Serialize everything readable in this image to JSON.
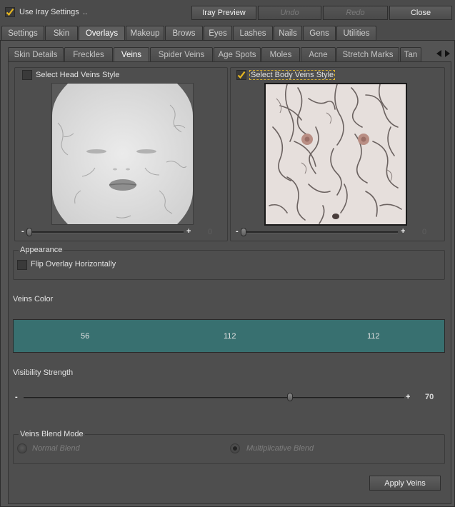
{
  "topbar": {
    "use_iray_label": "Use Iray Settings",
    "use_iray_checked": true,
    "ellipsis": "..",
    "iray_preview": "Iray Preview",
    "undo": "Undo",
    "redo": "Redo",
    "close": "Close"
  },
  "main_tabs": [
    "Settings",
    "Skin",
    "Overlays",
    "Makeup",
    "Brows",
    "Eyes",
    "Lashes",
    "Nails",
    "Gens",
    "Utilities"
  ],
  "main_tab_active": "Overlays",
  "sub_tabs": [
    "Skin Details",
    "Freckles",
    "Veins",
    "Spider Veins",
    "Age Spots",
    "Moles",
    "Acne",
    "Stretch Marks",
    "Tan"
  ],
  "sub_tab_active": "Veins",
  "scroll_left_icon": "triangle-left-icon",
  "scroll_right_icon": "triangle-right-icon",
  "head_style": {
    "label": "Select Head Veins Style",
    "checked": false,
    "slider_value": "0",
    "slider_level": 0
  },
  "body_style": {
    "label": "Select Body Veins Style",
    "checked": true,
    "slider_value": "0",
    "slider_level": 0
  },
  "appearance": {
    "title": "Appearance",
    "flip_label": "Flip Overlay Horizontally",
    "flip_checked": false
  },
  "veins_color": {
    "label": "Veins Color",
    "r": "56",
    "g": "112",
    "b": "112",
    "hex": "#387070"
  },
  "visibility": {
    "label": "Visibility Strength",
    "value": "70",
    "level": 70
  },
  "blend_mode": {
    "title": "Veins Blend Mode",
    "normal": "Normal Blend",
    "multiplicative": "Multiplicative Blend",
    "selected": "multiplicative"
  },
  "apply_button": "Apply Veins",
  "slider_minus": "-",
  "slider_plus": "+",
  "colors": {
    "background": "#4b4b4b",
    "accent_check": "#e8b820",
    "veins_color": "#387070"
  }
}
